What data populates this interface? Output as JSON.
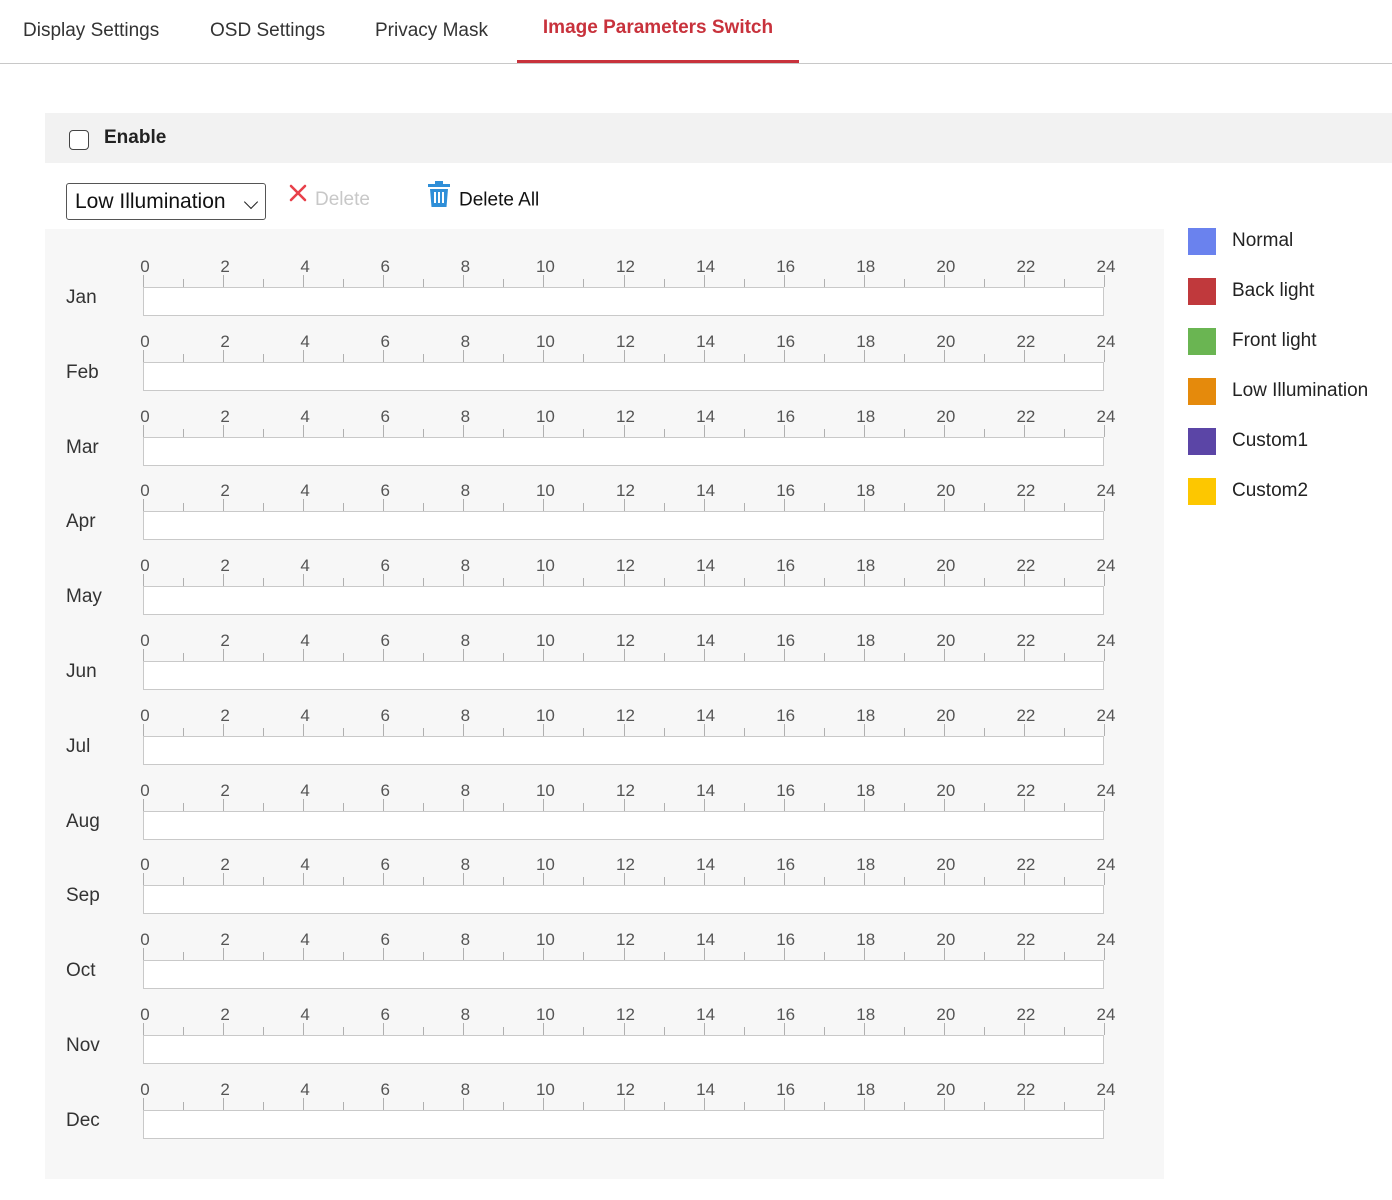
{
  "tabs": [
    {
      "label": "Display Settings",
      "active": false
    },
    {
      "label": "OSD Settings",
      "active": false
    },
    {
      "label": "Privacy Mask",
      "active": false
    },
    {
      "label": "Image Parameters Switch",
      "active": true
    }
  ],
  "enable": {
    "label": "Enable",
    "checked": false
  },
  "toolbar": {
    "mode_selected": "Low Illumination",
    "delete_label": "Delete",
    "delete_all_label": "Delete All"
  },
  "schedule": {
    "hour_ticks": [
      "0",
      "2",
      "4",
      "6",
      "8",
      "10",
      "12",
      "14",
      "16",
      "18",
      "20",
      "22",
      "24"
    ],
    "months": [
      "Jan",
      "Feb",
      "Mar",
      "Apr",
      "May",
      "Jun",
      "Jul",
      "Aug",
      "Sep",
      "Oct",
      "Nov",
      "Dec"
    ]
  },
  "legend": [
    {
      "label": "Normal",
      "color": "#6a82ee"
    },
    {
      "label": "Back light",
      "color": "#c0393c"
    },
    {
      "label": "Front light",
      "color": "#6ab552"
    },
    {
      "label": "Low Illumination",
      "color": "#e58a0c"
    },
    {
      "label": "Custom1",
      "color": "#5b45a6"
    },
    {
      "label": "Custom2",
      "color": "#fdc700"
    }
  ],
  "colors": {
    "accent": "#c8323c",
    "delete_icon": "#e8404a",
    "trash_icon": "#2f8fd8"
  }
}
